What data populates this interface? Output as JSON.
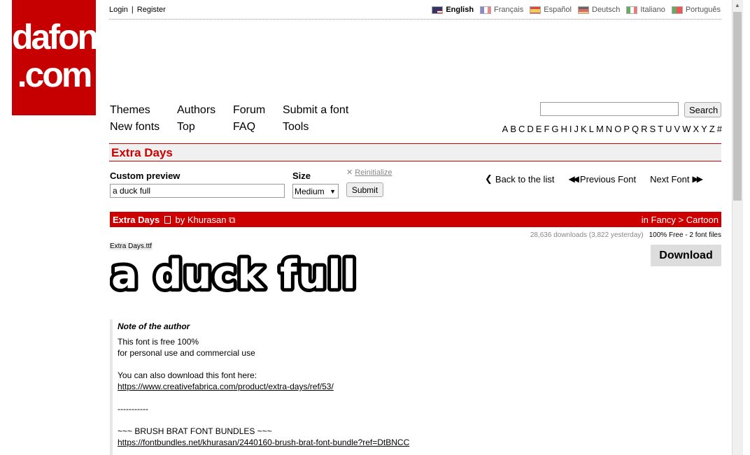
{
  "logo": {
    "line1": "dafont",
    "line2": ".com"
  },
  "toplinks": {
    "login": "Login",
    "sep": "|",
    "register": "Register"
  },
  "languages": [
    {
      "label": "English",
      "active": true
    },
    {
      "label": "Français",
      "active": false
    },
    {
      "label": "Español",
      "active": false
    },
    {
      "label": "Deutsch",
      "active": false
    },
    {
      "label": "Italiano",
      "active": false
    },
    {
      "label": "Português",
      "active": false
    }
  ],
  "nav": {
    "themes": "Themes",
    "authors": "Authors",
    "forum": "Forum",
    "submit": "Submit a font",
    "new_fonts": "New fonts",
    "top": "Top",
    "faq": "FAQ",
    "tools": "Tools"
  },
  "search": {
    "value": "",
    "button": "Search"
  },
  "alphabet": [
    "A",
    "B",
    "C",
    "D",
    "E",
    "F",
    "G",
    "H",
    "I",
    "J",
    "K",
    "L",
    "M",
    "N",
    "O",
    "P",
    "Q",
    "R",
    "S",
    "T",
    "U",
    "V",
    "W",
    "X",
    "Y",
    "Z",
    "#"
  ],
  "font": {
    "title": "Extra Days",
    "name": "Extra Days",
    "by": "by",
    "author": "Khurasan",
    "category": "in Fancy > Cartoon",
    "stats": "28,636 downloads (3,822 yesterday)",
    "license": "100% Free - 2 font files",
    "download": "Download",
    "filename": "Extra Days.ttf",
    "preview_text": "a duck full"
  },
  "preview_controls": {
    "custom_label": "Custom preview",
    "custom_value": "a duck full",
    "size_label": "Size",
    "size_value": "Medium",
    "reinit": "Reinitialize",
    "submit": "Submit",
    "back": "Back to the list",
    "prev": "Previous Font",
    "next": "Next Font"
  },
  "note": {
    "heading": "Note of the author",
    "line1": "This font is free 100%",
    "line2": "for personal use and commercial use",
    "line3": "You can also download this font here:",
    "link1": "https://www.creativefabrica.com/product/extra-days/ref/53/",
    "line4": "-----------",
    "line5": "~~~ BRUSH BRAT FONT BUNDLES ~~~",
    "link2": "https://fontbundles.net/khurasan/2440160-brush-brat-font-bundle?ref=DtBNCC"
  }
}
